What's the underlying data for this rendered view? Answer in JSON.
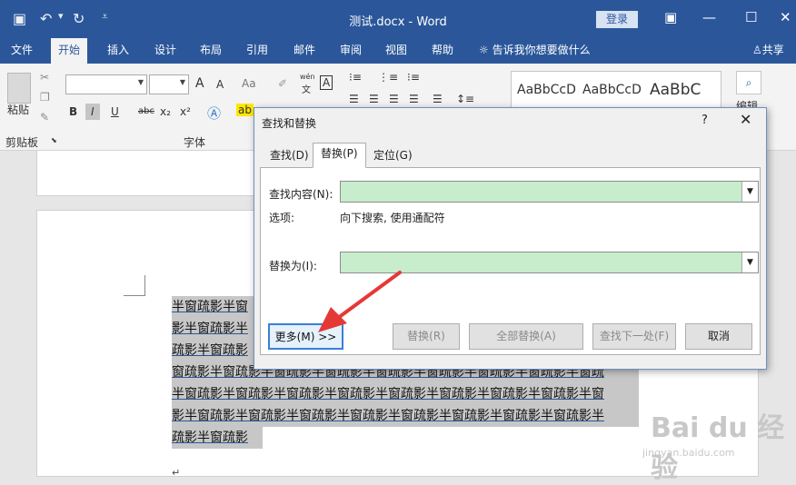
{
  "window": {
    "title": "测试.docx - Word",
    "login_label": "登录"
  },
  "tabs": [
    {
      "label": "文件"
    },
    {
      "label": "开始"
    },
    {
      "label": "插入"
    },
    {
      "label": "设计"
    },
    {
      "label": "布局"
    },
    {
      "label": "引用"
    },
    {
      "label": "邮件"
    },
    {
      "label": "审阅"
    },
    {
      "label": "视图"
    },
    {
      "label": "帮助"
    }
  ],
  "tell_me": "告诉我你想要做什么",
  "share_label": "共享",
  "ribbon": {
    "paste_label": "粘贴",
    "clipboard_label": "剪贴板",
    "font_label": "字体",
    "style_samples": [
      "AaBbCcD",
      "AaBbCcD",
      "AaBbC"
    ],
    "edit_label": "编辑",
    "font_buttons": {
      "bold": "B",
      "italic": "I",
      "underline": "U",
      "strike": "abc",
      "sub": "x₂",
      "sup": "x²"
    },
    "wen": "wén",
    "wen_char": "文",
    "font_size_up": "A",
    "font_size_down": "A",
    "aa": "Aa",
    "border_a": "A"
  },
  "dialog": {
    "title": "查找和替换",
    "help": "?",
    "tabs": [
      "查找(D)",
      "替换(P)",
      "定位(G)"
    ],
    "find_label": "查找内容(N):",
    "options_label": "选项:",
    "options_value": "向下搜索, 使用通配符",
    "replace_label": "替换为(I):",
    "buttons": {
      "more": "更多(M) >>",
      "replace": "替换(R)",
      "replace_all": "全部替换(A)",
      "find_next": "查找下一处(F)",
      "cancel": "取消"
    }
  },
  "document": {
    "lines": [
      "半窗疏影半窗",
      "影半窗疏影半",
      "疏影半窗疏影",
      "窗疏影半窗疏影半窗疏影半窗疏影半窗疏影半窗疏影半窗疏影半窗疏影半窗疏",
      "半窗疏影半窗疏影半窗疏影半窗疏影半窗疏影半窗疏影半窗疏影半窗疏影半窗",
      "影半窗疏影半窗疏影半窗疏影半窗疏影半窗疏影半窗疏影半窗疏影半窗疏影半",
      "疏影半窗疏影"
    ]
  },
  "watermark": {
    "brand": "Bai du 经验",
    "url": "jingyan.baidu.com"
  },
  "colors": {
    "word_blue": "#2b579a",
    "input_green": "#c7edcc",
    "annotation_red": "#e53935"
  }
}
